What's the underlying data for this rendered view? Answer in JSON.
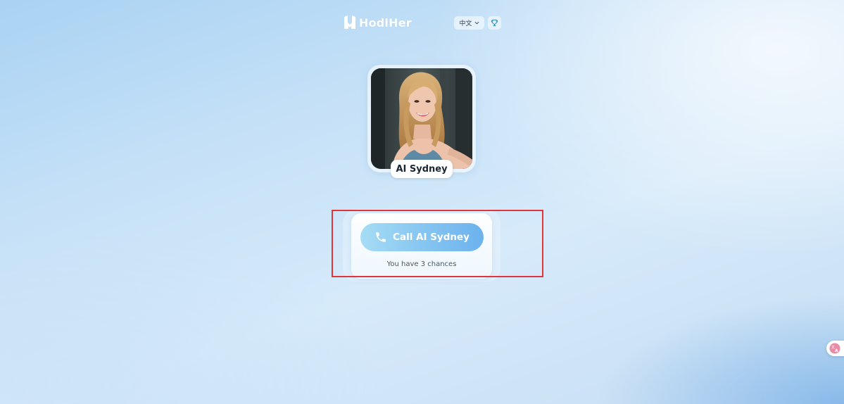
{
  "header": {
    "brand": "HodlHer",
    "language_label": "中文",
    "icons": [
      "logo-icon",
      "chevron-down-icon",
      "trophy-icon"
    ]
  },
  "profile": {
    "name": "AI Sydney",
    "avatar_alt": "AI Sydney avatar"
  },
  "call": {
    "button_label": "Call AI Sydney",
    "button_icon": "phone-icon",
    "chances_text": "You have 3 chances"
  },
  "side_widget": {
    "icon": "translate-icon"
  },
  "colors": {
    "accent": "#84c4f1",
    "highlight": "#e0353a",
    "background": "#c4e0f7"
  }
}
